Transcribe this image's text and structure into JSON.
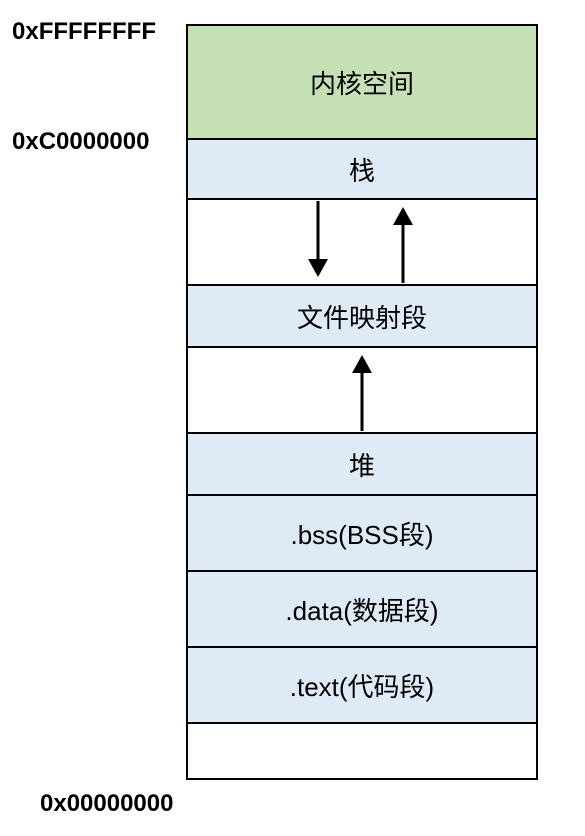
{
  "addresses": {
    "top": "0xFFFFFFFF",
    "kernel_boundary": "0xC0000000",
    "bottom": "0x00000000"
  },
  "segments": {
    "kernel": "内核空间",
    "stack": "栈",
    "mmap": "文件映射段",
    "heap": "堆",
    "bss": ".bss(BSS段)",
    "data": ".data(数据段)",
    "text": ".text(代码段)"
  }
}
